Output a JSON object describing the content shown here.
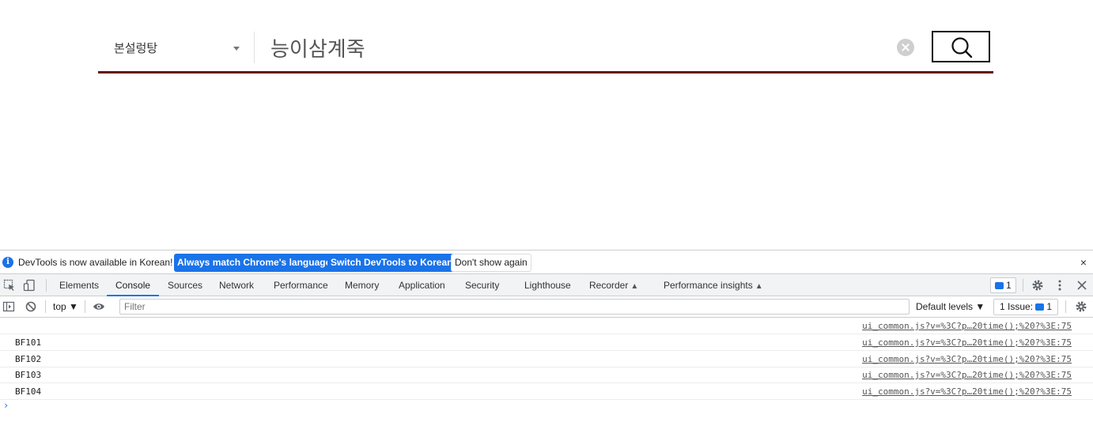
{
  "search": {
    "store_selected": "본설렁탕",
    "query": "능이삼계죽"
  },
  "devtools": {
    "infobar": {
      "message": "DevTools is now available in Korean!",
      "btn_match": "Always match Chrome's language",
      "btn_switch": "Switch DevTools to Korean",
      "btn_dont_show": "Don't show again",
      "close": "×"
    },
    "tabs": [
      {
        "label": "Elements"
      },
      {
        "label": "Console"
      },
      {
        "label": "Sources"
      },
      {
        "label": "Network"
      },
      {
        "label": "Performance"
      },
      {
        "label": "Memory"
      },
      {
        "label": "Application"
      },
      {
        "label": "Security"
      },
      {
        "label": "Lighthouse"
      },
      {
        "label": "Recorder"
      },
      {
        "label": "Performance insights"
      }
    ],
    "messages_count": "1",
    "filterbar": {
      "context": "top ▼",
      "filter_placeholder": "Filter",
      "levels": "Default levels ▼",
      "issues_label": "1 Issue:",
      "issues_count": "1"
    },
    "console": {
      "rows": [
        {
          "text": "",
          "source": "ui_common.js?v=%3C?p…20time();%20?%3E:75"
        },
        {
          "text": "BF101",
          "source": "ui_common.js?v=%3C?p…20time();%20?%3E:75"
        },
        {
          "text": "BF102",
          "source": "ui_common.js?v=%3C?p…20time();%20?%3E:75"
        },
        {
          "text": "BF103",
          "source": "ui_common.js?v=%3C?p…20time();%20?%3E:75"
        },
        {
          "text": "BF104",
          "source": "ui_common.js?v=%3C?p…20time();%20?%3E:75"
        }
      ],
      "prompt": "›"
    }
  },
  "colors": {
    "search_underline": "#6b0a0a",
    "accent_blue": "#1a73e8"
  }
}
